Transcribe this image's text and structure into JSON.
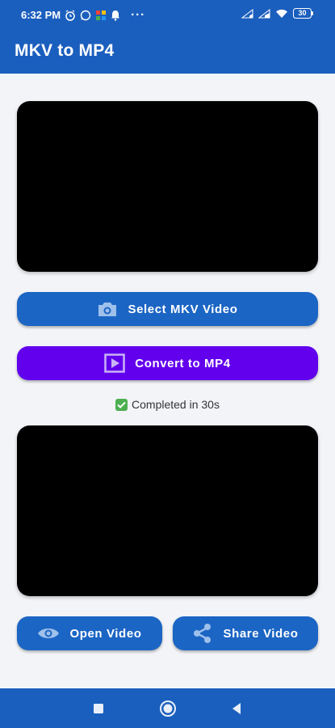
{
  "status_bar": {
    "time": "6:32 PM",
    "dots": "···",
    "battery": "30",
    "icons": [
      "alarm-icon",
      "whatsapp-icon",
      "app-grid-icon",
      "notification-bell-icon",
      "signal-icon",
      "signal-icon",
      "wifi-icon",
      "battery-icon"
    ]
  },
  "app_bar": {
    "title": "MKV to MP4"
  },
  "buttons": {
    "select": {
      "label": "Select MKV Video",
      "icon": "camera-icon"
    },
    "convert": {
      "label": "Convert to MP4",
      "icon": "play-icon"
    },
    "open": {
      "label": "Open Video",
      "icon": "eye-icon"
    },
    "share": {
      "label": "Share Video",
      "icon": "share-icon"
    }
  },
  "status_message": {
    "icon": "check-icon",
    "text": "Completed in 30s"
  },
  "nav_bar": {
    "icons": [
      "recents-square-icon",
      "home-circle-icon",
      "back-triangle-icon"
    ]
  },
  "colors": {
    "primary": "#1b5fbe",
    "button_blue": "#1b65c4",
    "convert_purple": "#6200ee",
    "background": "#f2f4f8"
  }
}
